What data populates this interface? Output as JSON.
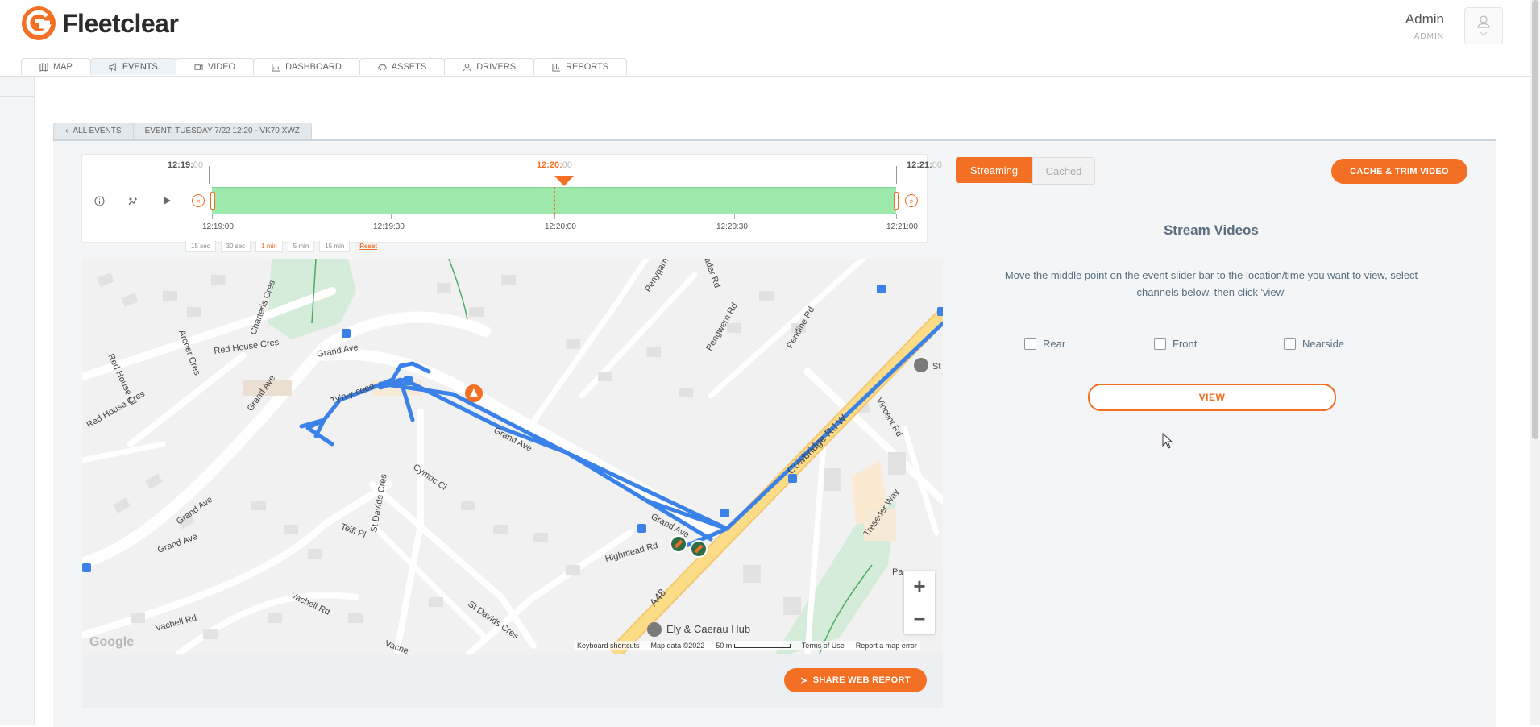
{
  "app": {
    "name": "Fleetclear",
    "brand_color": "#f26f24"
  },
  "user": {
    "name": "Admin",
    "role": "ADMIN"
  },
  "nav": {
    "tabs": [
      {
        "label": "MAP",
        "icon": "map-icon"
      },
      {
        "label": "EVENTS",
        "icon": "megaphone-icon",
        "active": true
      },
      {
        "label": "VIDEO",
        "icon": "video-icon"
      },
      {
        "label": "DASHBOARD",
        "icon": "dashboard-icon"
      },
      {
        "label": "ASSETS",
        "icon": "car-icon"
      },
      {
        "label": "DRIVERS",
        "icon": "person-icon"
      },
      {
        "label": "REPORTS",
        "icon": "reports-icon"
      }
    ]
  },
  "breadcrumb": {
    "back": "ALL EVENTS",
    "current": "EVENT: TUESDAY 7/22 12:20 - VK70 XWZ"
  },
  "timeline": {
    "start": {
      "hm": "12:19:",
      "s": "00"
    },
    "center": {
      "hm": "12:20:",
      "s": "00"
    },
    "end": {
      "hm": "12:21:",
      "s": "00"
    },
    "ticks": [
      "12:19:00",
      "12:19:30",
      "12:20:00",
      "12:20:30",
      "12:21:00"
    ],
    "zoom_options": [
      "15 sec",
      "30 sec",
      "1 min",
      "5 min",
      "15 min"
    ],
    "zoom_selected": "1 min",
    "reset_label": "Reset"
  },
  "map": {
    "labels": {
      "archer": "Archer Cres",
      "charteris": "Charteris Cres",
      "red_house_cl": "Red House Cl",
      "red_house_cres1": "Red House Cres",
      "red_house_cres2": "Red House Cres",
      "grand_ave_top": "Grand Ave",
      "grand_ave_left": "Grand Ave",
      "grand_ave_mid": "Grand Ave",
      "grand_ave_bl1": "Grand Ave",
      "grand_ave_bl2": "Grand Ave",
      "grand_ave_right": "Grand Ave",
      "tylan": "Ty'n-y-coed",
      "cymric": "Cymric Cl",
      "st_davids1": "St Davids Cres",
      "st_davids2": "St Davids Cres",
      "teifi": "Teifi Pl",
      "highmead": "Highmead Rd",
      "vachell1": "Vachell Rd",
      "vachell2": "Vachell Rd",
      "vachell3": "Vache",
      "penygarn": "Penygarn",
      "pengwern": "Pengwern Rd",
      "pendine": "Pendine Rd",
      "ader": "ader Rd",
      "cowbridge": "Cowbridge Rd W",
      "vincent": "Vincent Rd",
      "treseder": "Treseder Way",
      "a48": "A48",
      "hub": "Ely & Caerau Hub",
      "st": "St",
      "pa": "Pa"
    },
    "footer": {
      "shortcuts": "Keyboard shortcuts",
      "data": "Map data ©2022",
      "scale": "50 m",
      "terms": "Terms of Use",
      "report": "Report a map error"
    },
    "google": "Google",
    "route_color": "#3b82e8"
  },
  "share_label": "SHARE WEB REPORT",
  "right": {
    "mode": {
      "streaming": "Streaming",
      "cached": "Cached"
    },
    "cache_trim_label": "CACHE & TRIM VIDEO",
    "title": "Stream Videos",
    "description": "Move the middle point on the event slider bar to the location/time you want to view, select channels below, then click 'view'",
    "channels": [
      "Rear",
      "Front",
      "Nearside"
    ],
    "view_label": "VIEW"
  }
}
